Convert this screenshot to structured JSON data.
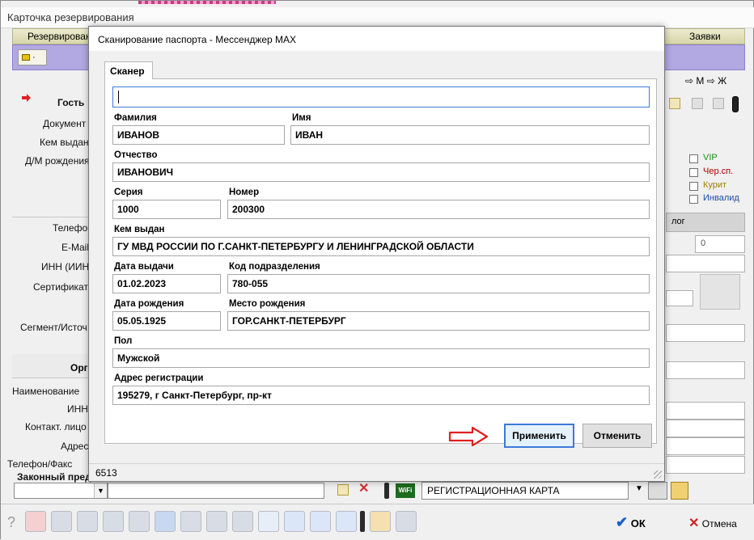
{
  "window": {
    "title": "Карточка резервирования",
    "tab_left": "Резервировани",
    "tab_right": "Заявки",
    "nav_right": "⇨ М ⇨ Ж"
  },
  "guest_labels": {
    "guest": "Гость",
    "document": "Документ",
    "issued_by": "Кем выдан",
    "birth": "Д/М рождения",
    "phone": "Телефон",
    "email": "E-Mail",
    "inn": "ИНН (ИИН)",
    "certificate": "Сертификат",
    "segment": "Сегмент/Источ."
  },
  "org_labels": {
    "header": "Орга",
    "name": "Наименование",
    "inn": "ИНН",
    "contact": "Контакт. лицо",
    "address": "Адрес",
    "phone_fax": "Телефон/Факс",
    "legal": "Законный пред"
  },
  "flags": {
    "vip": "VIP",
    "blacklist": "Чер.сп.",
    "smoker": "Курит",
    "invalid": "Инвалид"
  },
  "right_panel": {
    "header": "лог",
    "count": "0"
  },
  "bottom": {
    "reg_card": "РЕГИСТРАЦИОННАЯ КАРТА",
    "wifi_label": "WiFi",
    "ok": "ОК",
    "cancel": "Отмена"
  },
  "dialog": {
    "title": "Сканирование паспорта - Мессенджер MAX",
    "tab": "Сканер",
    "scanner_value": "",
    "fields": {
      "surname_label": "Фамилия",
      "surname": "ИВАНОВ",
      "name_label": "Имя",
      "name": "ИВАН",
      "patronymic_label": "Отчество",
      "patronymic": "ИВАНОВИЧ",
      "series_label": "Серия",
      "series": "1000",
      "number_label": "Номер",
      "number": "200300",
      "issued_by_label": "Кем выдан",
      "issued_by": "ГУ МВД РОССИИ ПО Г.САНКТ-ПЕТЕРБУРГУ И ЛЕНИНГРАДСКОЙ ОБЛАСТИ",
      "issue_date_label": "Дата выдачи",
      "issue_date": "01.02.2023",
      "division_code_label": "Код подразделения",
      "division_code": "780-055",
      "birth_date_label": "Дата рождения",
      "birth_date": "05.05.1925",
      "birth_place_label": "Место рождения",
      "birth_place": "ГОР.САНКТ-ПЕТЕРБУРГ",
      "sex_label": "Пол",
      "sex": "Мужской",
      "address_label": "Адрес регистрации",
      "address": "195279, г Санкт-Петербург, пр-кт"
    },
    "apply": "Применить",
    "cancel": "Отменить",
    "status": "6513"
  },
  "colors": {
    "focus_blue": "#3d7ad6",
    "arrow_red": "#e02020",
    "tab_purple": "#b2a8e2"
  }
}
